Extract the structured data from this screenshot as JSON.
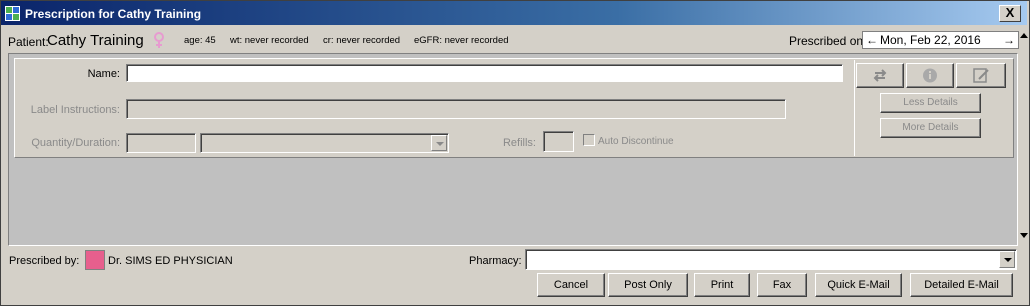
{
  "window": {
    "title": "Prescription for Cathy Training",
    "close_label": "X"
  },
  "patient": {
    "label": "Patient:",
    "name": "Cathy Training",
    "sex_icon": "female-icon",
    "age": "age: 45",
    "weight": "wt: never recorded",
    "cr": "cr: never recorded",
    "egfr": "eGFR: never recorded"
  },
  "prescribed_on": {
    "label": "Prescribed on:",
    "prev_arrow": "←",
    "date": "Mon, Feb 22, 2016",
    "next_arrow": "→"
  },
  "form": {
    "name_label": "Name:",
    "name_value": "",
    "label_instructions_label": "Label Instructions:",
    "label_instructions_value": "",
    "quantity_duration_label": "Quantity/Duration:",
    "quantity_value": "",
    "duration_value": "",
    "refills_label": "Refills:",
    "refills_value": "",
    "auto_discontinue_label": "Auto Discontinue",
    "auto_discontinue_checked": false
  },
  "side_buttons": {
    "swap_icon": "swap-arrows-icon",
    "info_icon": "info-icon",
    "edit_icon": "edit-note-icon",
    "less_details": "Less Details",
    "more_details": "More Details"
  },
  "footer": {
    "prescribed_by_label": "Prescribed by:",
    "prescriber_color": "#e75f8d",
    "prescriber_name": "Dr. SIMS ED PHYSICIAN",
    "pharmacy_label": "Pharmacy:",
    "pharmacy_value": "",
    "buttons": {
      "cancel": "Cancel",
      "post_only": "Post Only",
      "print": "Print",
      "fax": "Fax",
      "quick_email": "Quick E-Mail",
      "detailed_email": "Detailed E-Mail"
    }
  }
}
